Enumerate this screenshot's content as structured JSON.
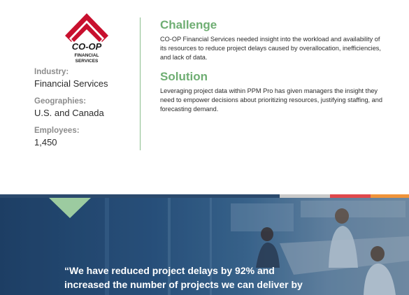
{
  "company": {
    "logo_name": "CO-OP",
    "logo_sub_line1": "FINANCIAL",
    "logo_sub_line2": "SERVICES"
  },
  "meta": [
    {
      "label": "Industry:",
      "value": "Financial Services"
    },
    {
      "label": "Geographies:",
      "value": "U.S. and Canada"
    },
    {
      "label": "Employees:",
      "value": "1,450"
    }
  ],
  "challenge": {
    "title": "Challenge",
    "body": "CO-OP Financial Services needed insight into the workload and availability of its resources to reduce project delays caused by overallocation, inefficiencies, and lack of data."
  },
  "solution": {
    "title": "Solution",
    "body": "Leveraging project data within PPM Pro has given managers the insight they need to empower decisions about prioritizing resources, justifying staffing, and forecasting demand."
  },
  "quote": {
    "line1": "“We have reduced project delays by 92% and",
    "line2": "increased the number of projects we can deliver by"
  },
  "colors": {
    "accent_green": "#6fae73",
    "logo_red": "#c8102e",
    "strip_navy": "#2b4a6d",
    "strip_gray": "#c9c9c9",
    "strip_red": "#e0484c",
    "strip_orange": "#f0943a"
  }
}
